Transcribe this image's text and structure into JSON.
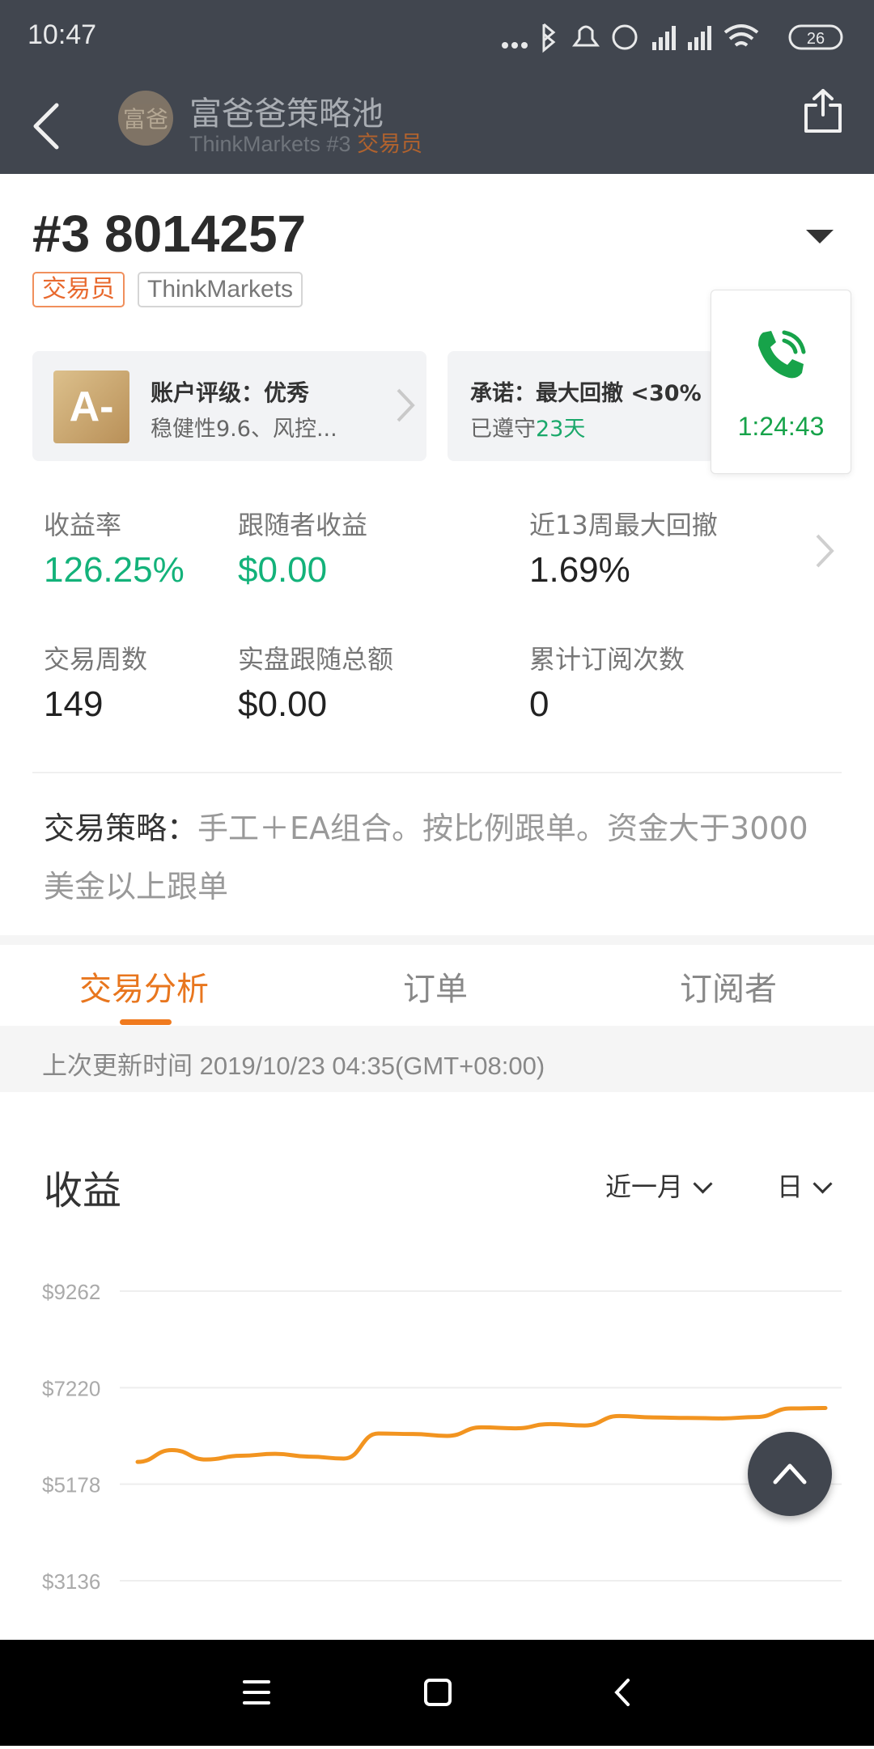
{
  "status_bar": {
    "time": "10:47",
    "battery": "26"
  },
  "header": {
    "avatar_text": "富爸",
    "title": "富爸爸策略池",
    "subtitle_prefix": "ThinkMarkets #3 ",
    "subtitle_role": "交易员"
  },
  "account": {
    "title": "#3 8014257",
    "tags": [
      "交易员",
      "ThinkMarkets"
    ]
  },
  "rating_card": {
    "grade": "A-",
    "label": "账户评级：优秀",
    "desc": "稳健性9.6、风控..."
  },
  "promise_card": {
    "label": "承诺：最大回撤 <30%",
    "desc_prefix": "已遵守",
    "desc_value": "23天"
  },
  "call": {
    "timer": "1:24:43"
  },
  "stats": [
    {
      "label": "收益率",
      "value": "126.25%"
    },
    {
      "label": "跟随者收益",
      "value": "$0.00"
    },
    {
      "label": "近13周最大回撤",
      "value": "1.69%"
    },
    {
      "label": "交易周数",
      "value": "149"
    },
    {
      "label": "实盘跟随总额",
      "value": "$0.00"
    },
    {
      "label": "累计订阅次数",
      "value": "0"
    }
  ],
  "strategy": {
    "lead": "交易策略：",
    "text": "手工＋EA组合。按比例跟单。资金大于3000美金以上跟单"
  },
  "tabs": [
    "交易分析",
    "订单",
    "订阅者"
  ],
  "update_text": "上次更新时间 2019/10/23 04:35(GMT+08:00)",
  "section": {
    "title": "收益",
    "period": "近一月",
    "granularity": "日"
  },
  "colors": {
    "accent": "#e8761e",
    "green": "#13b27a",
    "header_bg": "#41464f",
    "line": "#f29420"
  },
  "chart_data": {
    "type": "line",
    "y_ticks": [
      "$9262",
      "$7220",
      "$5178",
      "$3136"
    ],
    "ylim": [
      3136,
      9262
    ],
    "series": [
      {
        "values": [
          5650,
          5900,
          5700,
          5780,
          5820,
          5760,
          5720,
          6250,
          6240,
          6200,
          6380,
          6360,
          6450,
          6420,
          6620,
          6590,
          6580,
          6570,
          6600,
          6780,
          6790
        ]
      }
    ]
  }
}
